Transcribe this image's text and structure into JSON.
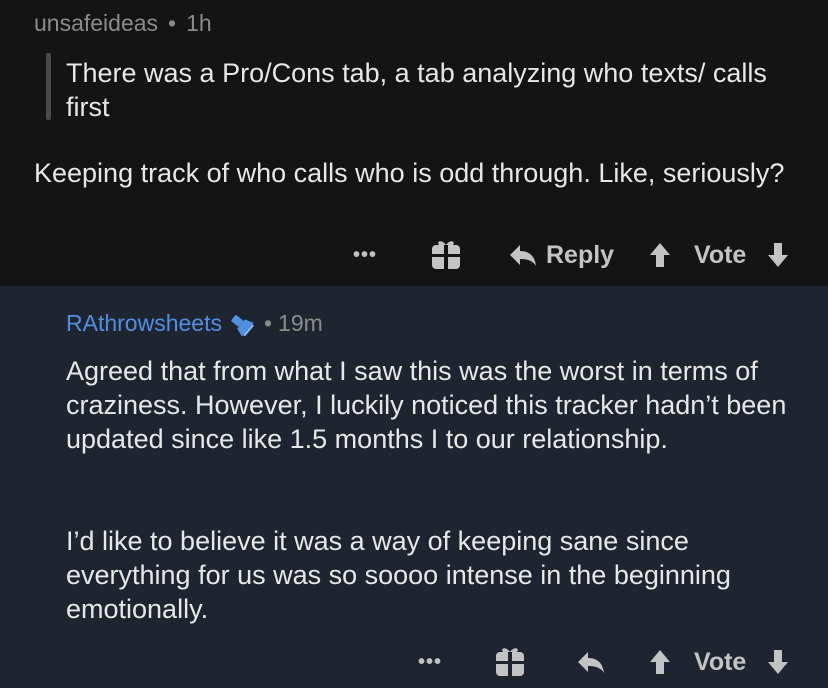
{
  "comments": [
    {
      "username": "unsafeideas",
      "separator": "•",
      "time": "1h",
      "quote": "There was a Pro/Cons tab, a tab analyzing who texts/ calls first",
      "body": [
        "Keeping track of who calls who is odd through. Like, seriously?"
      ],
      "actions": {
        "more": "•••",
        "reply": "Reply",
        "vote": "Vote"
      }
    },
    {
      "username": "RAthrowsheets",
      "user_icon": "flashlight-icon",
      "separator": "•",
      "time": "19m",
      "body": [
        "Agreed that from what I saw this was the worst in terms of craziness. However, I luckily noticed this tracker hadn’t been updated since like 1.5 months I to our relationship.",
        "I’d like to believe it was a way of keeping sane since everything for us was so soooo intense in the beginning emotionally."
      ],
      "actions": {
        "more": "•••",
        "vote": "Vote"
      }
    }
  ],
  "colors": {
    "top_bg": "#141414",
    "bottom_bg": "#1f2530",
    "username_accent": "#4f8fe0"
  }
}
